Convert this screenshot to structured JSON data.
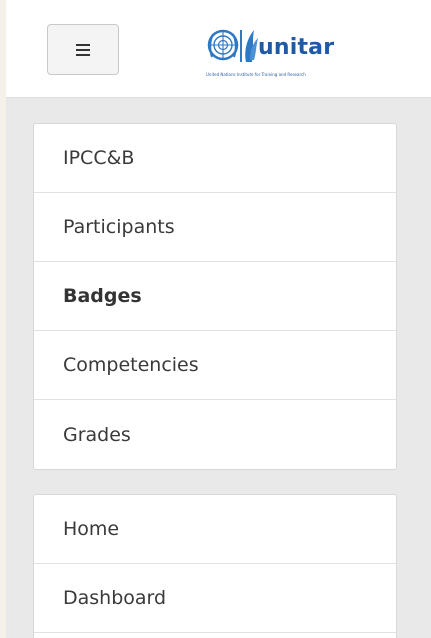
{
  "header": {
    "menu_icon": "hamburger-icon",
    "logo": {
      "emblem": "un-emblem-icon",
      "wordmark": "unitar",
      "tagline": "United Nations Institute for Training and Research",
      "brand_color": "#1f5aa6"
    }
  },
  "course_nav": {
    "items": [
      {
        "label": "IPCC&B",
        "active": false
      },
      {
        "label": "Participants",
        "active": false
      },
      {
        "label": "Badges",
        "active": true
      },
      {
        "label": "Competencies",
        "active": false
      },
      {
        "label": "Grades",
        "active": false
      }
    ]
  },
  "site_nav": {
    "items": [
      {
        "label": "Home"
      },
      {
        "label": "Dashboard"
      }
    ]
  }
}
